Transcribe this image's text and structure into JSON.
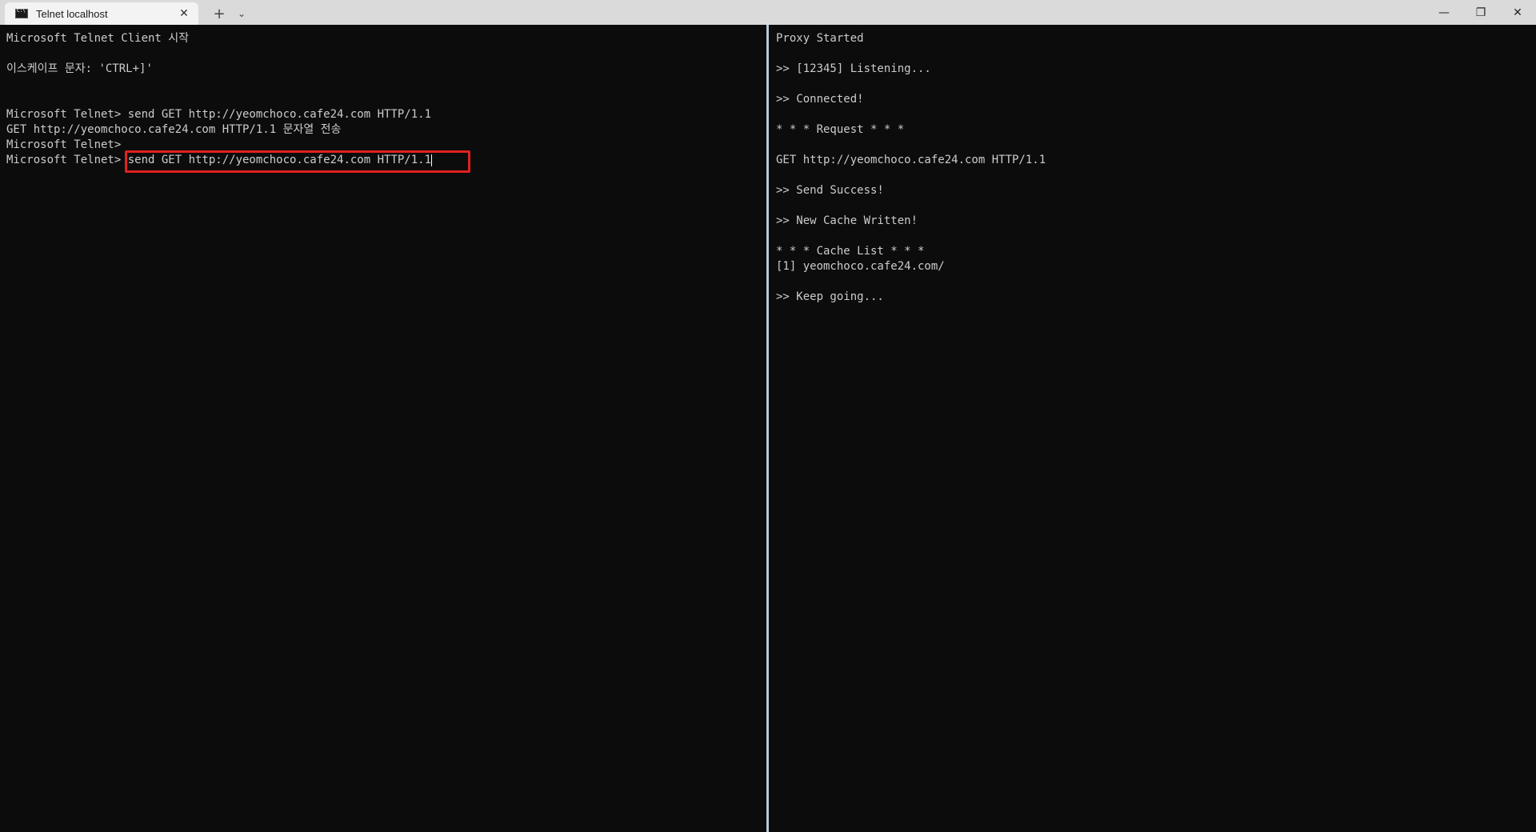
{
  "window": {
    "tab_title": "Telnet localhost",
    "tab_close": "✕",
    "new_tab": "+",
    "dropdown": "⌄",
    "minimize": "—",
    "restore": "❐",
    "close": "✕"
  },
  "left_pane": {
    "lines": [
      "Microsoft Telnet Client 시작",
      "",
      "이스케이프 문자: 'CTRL+]'",
      "",
      "",
      "Microsoft Telnet> send GET http://yeomchoco.cafe24.com HTTP/1.1",
      "GET http://yeomchoco.cafe24.com HTTP/1.1 문자열 전송",
      "Microsoft Telnet>"
    ],
    "prompt": "Microsoft Telnet> ",
    "current_input": "send GET http://yeomchoco.cafe24.com HTTP/1.1"
  },
  "right_pane": {
    "lines": [
      "Proxy Started",
      "",
      ">> [12345] Listening...",
      "",
      ">> Connected!",
      "",
      "* * * Request * * *",
      "",
      "GET http://yeomchoco.cafe24.com HTTP/1.1",
      "",
      ">> Send Success!",
      "",
      ">> New Cache Written!",
      "",
      "* * * Cache List * * *",
      "[1] yeomchoco.cafe24.com/",
      "",
      ">> Keep going..."
    ]
  },
  "colors": {
    "terminal_bg": "#0c0c0c",
    "terminal_fg": "#cccccc",
    "highlight": "#e02020",
    "divider": "#b9c9da"
  }
}
